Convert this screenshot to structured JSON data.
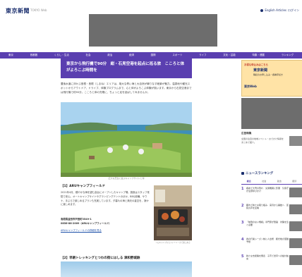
{
  "header": {
    "logo": "東京新聞",
    "logo_sub": "TOKYO Web",
    "english_label": "English Articles",
    "login_label": "ログイン"
  },
  "nav": {
    "items": [
      "東京",
      "首都圏",
      "くらし・生活",
      "社会",
      "政治",
      "経済",
      "国際",
      "スポーツ",
      "ライフ",
      "文化・芸能",
      "特集・連載",
      "ランキング"
    ]
  },
  "article": {
    "title": "東京から飛行機で90分　紺・石見空港を起点に巡る旅　こころと体がよろこぶ時間を",
    "lede": "豊後水道に浮かぶ島根・島根（しまね）エリアは、雄大な青い海と大自然が織りなす絶景が魅力。温泉地や観光スポットからアウトドア、ドライブ、体験プログラムまで、心と体がよろこぶ体験が揃います。東京から石見空港までは飛行機で約90分。こころと体の充電に、ちょっと足を延ばしてみませんか。",
    "photo1_caption": "広大な芝生に並ぶキャンプサイトと海",
    "section1_heading": "【1】ARUキャンプフィールド",
    "section1_body": "2021年4月、穏やかな海を望む高台にオープンしたキャンプ場。施設はスタッフ常駐で安心。オートキャンプサイトやグランピングテントのほか、BBQ設備、サウナ、手ぶらで楽しめるプランも充実しています。夕暮れの海と満天の星空を、静かに楽しめます。",
    "section1_address": "島根県益田市戸田町3549-1\n0856-88-2009（ARUキャンプフィールド）",
    "section1_link": "ARUキャンプフィールドの詳細を見る",
    "photo2_caption": "ソロキャンプからファミリーまで楽しめる",
    "section2_heading": "【2】早朝トレッキングとつわの街にはしる 津和野城跡"
  },
  "sidebar": {
    "ad_kicker": "お得な申込みはこちら",
    "ad_logo": "東京新聞",
    "ad_text": "購読のお申し込み・各種手続き",
    "ad_foot": "東京Web",
    "section_title": "広告特集",
    "section_line": "全国の注目の地域イベント・おでかけ情報をまとめて紹介。",
    "ranking_title": "ニュースランキング",
    "tabs": [
      "総合",
      "社会",
      "政治",
      "経済"
    ],
    "ranks": [
      {
        "num": "1",
        "text": "各地で大雪の恐れ　交通機関に影響　気象庁が注意呼びかけ"
      },
      {
        "num": "2",
        "text": "都内で新たな取り組み　来月から開始へ　区民の声を反映"
      },
      {
        "num": "3",
        "text": "「前例のない規模」専門家が警鐘　対策を急ぐ必要"
      },
      {
        "num": "4",
        "text": "春の行楽シーズン前に人出増　観光地の混雑予想"
      },
      {
        "num": "5",
        "text": "新たな支援策を発表　子育て世帯への給付拡充"
      }
    ]
  }
}
